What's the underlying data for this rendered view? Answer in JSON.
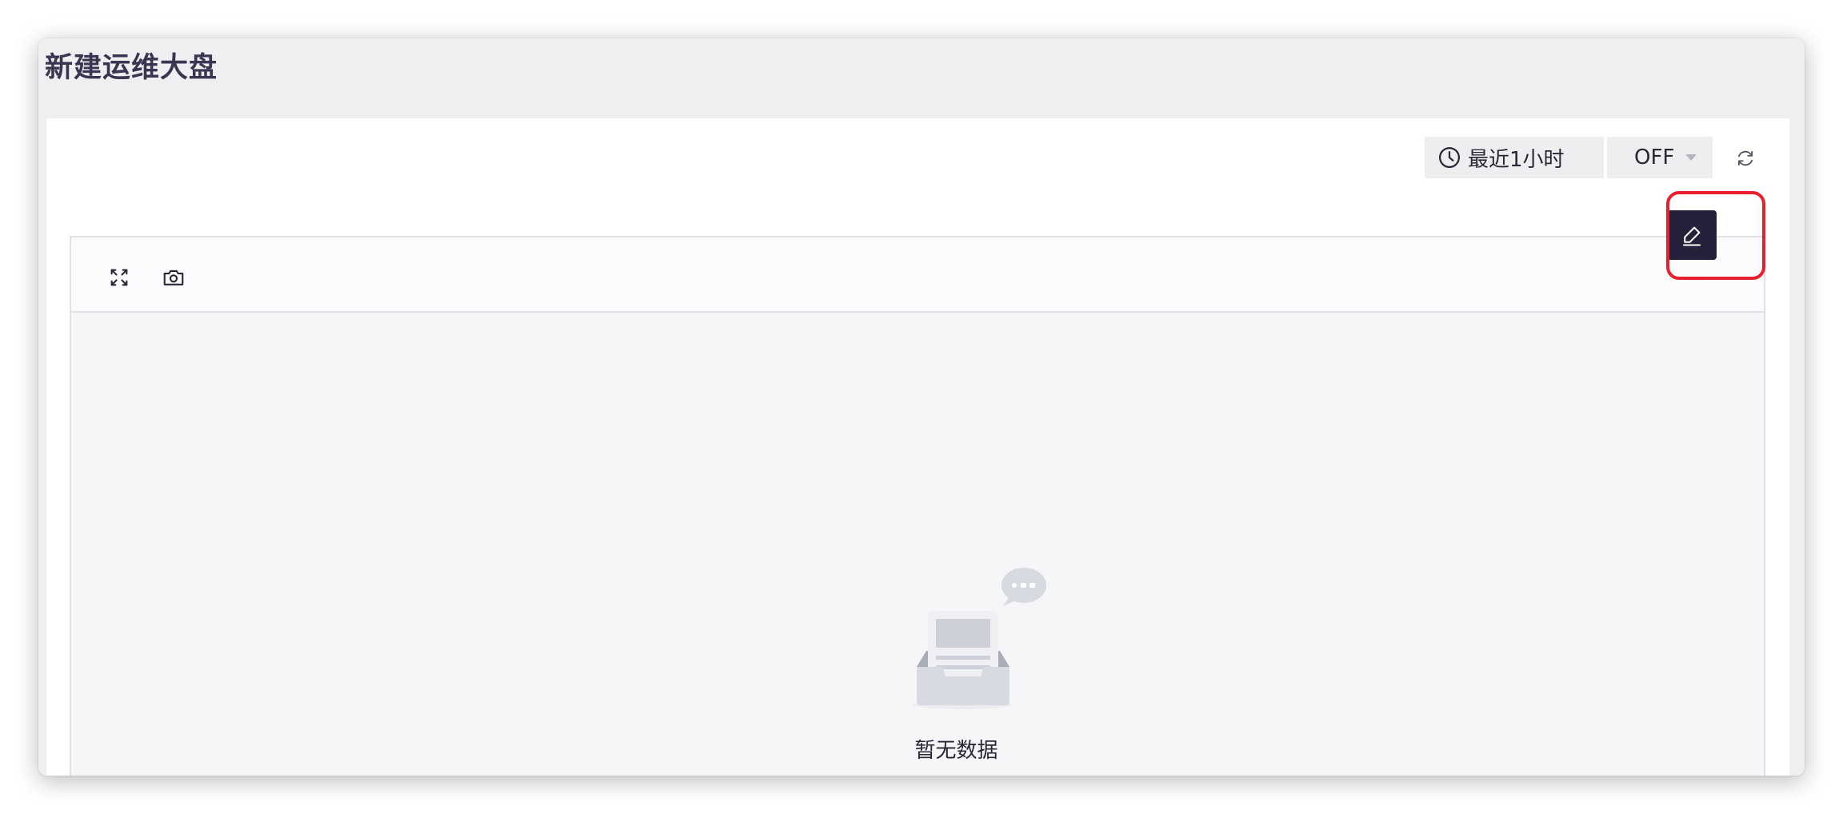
{
  "page": {
    "title": "新建运维大盘"
  },
  "controls": {
    "time_range_label": "最近1小时",
    "time_icon": "clock-icon",
    "refresh_interval_value": "OFF",
    "refresh_icon": "refresh-icon"
  },
  "panel": {
    "toolbar_icons": [
      "fullscreen-icon",
      "camera-icon"
    ],
    "edit_icon": "pencil-icon",
    "empty_text": "暂无数据",
    "empty_icon": "empty-inbox-icon"
  },
  "colors": {
    "title": "#3a3550",
    "edit_button_bg": "#25213a",
    "highlight": "#e8202e",
    "window_bg": "#efeff2",
    "panel_bg": "#f6f6f9"
  }
}
